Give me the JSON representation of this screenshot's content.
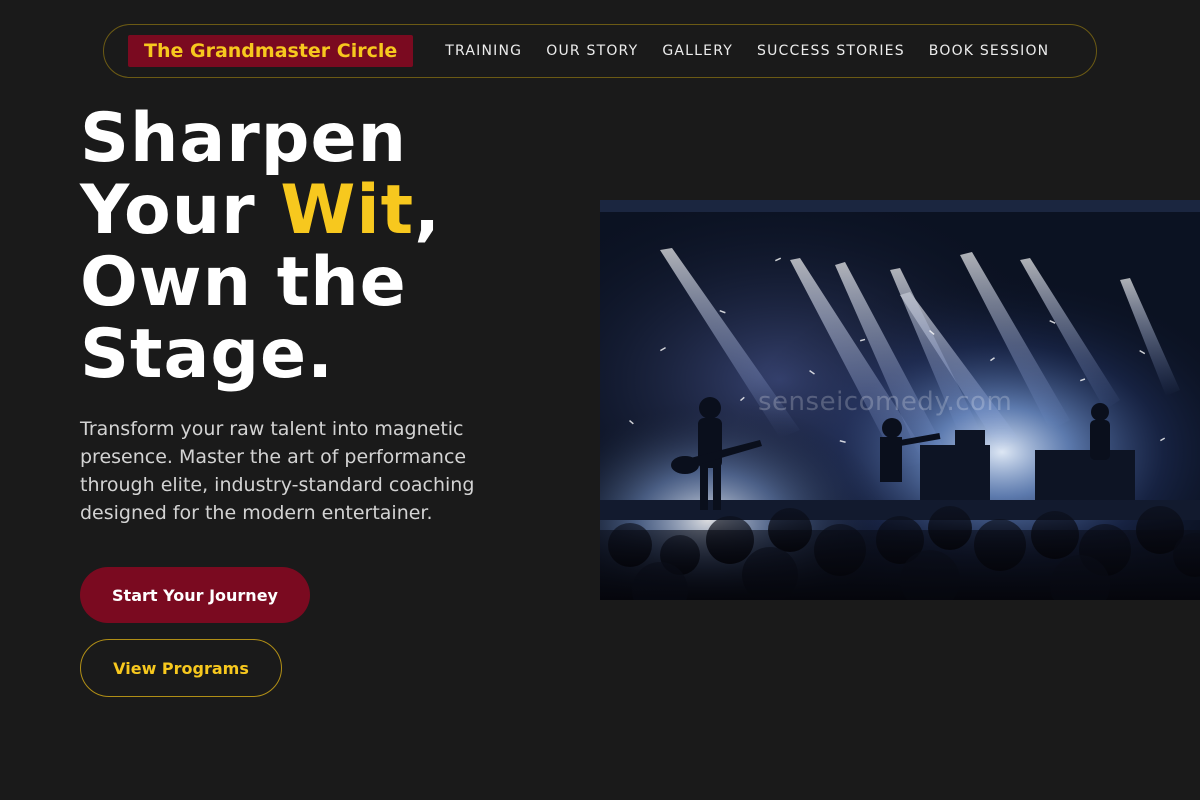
{
  "nav": {
    "brand": "The Grandmaster Circle",
    "links": [
      "TRAINING",
      "OUR STORY",
      "GALLERY",
      "SUCCESS STORIES",
      "BOOK SESSION"
    ]
  },
  "hero": {
    "headline_part1": "Sharpen Your ",
    "headline_accent": "Wit",
    "headline_part2": ", Own the Stage.",
    "subtitle": "Transform your raw talent into magnetic presence. Master the art of performance through elite, industry-standard coaching designed for the modern entertainer.",
    "primary_cta": "Start Your Journey",
    "secondary_cta": "View Programs",
    "image_watermark": "senseicomedy.com"
  },
  "colors": {
    "background": "#1a1a1a",
    "accent_gold": "#f7c81e",
    "brand_maroon": "#7a0a20"
  }
}
